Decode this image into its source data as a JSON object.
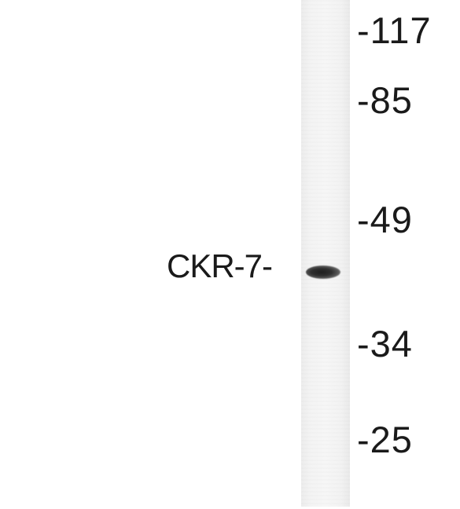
{
  "blot": {
    "protein_label": "CKR-7-",
    "markers": [
      "-117",
      "-85",
      "-49",
      "-34",
      "-25"
    ]
  },
  "colors": {
    "background": "#ffffff",
    "lane": "#f3f3f3",
    "band": "#222222",
    "text": "#1a1a1a"
  }
}
